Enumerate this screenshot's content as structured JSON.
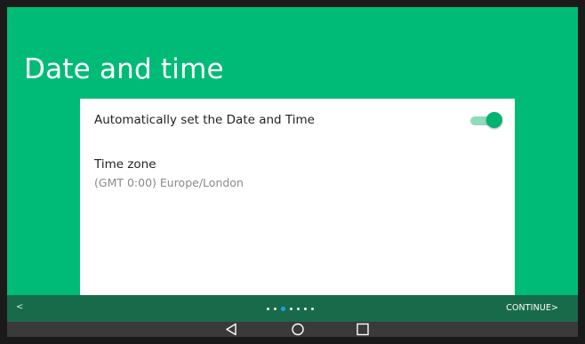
{
  "screen": {
    "title": "Date and time"
  },
  "settings": {
    "auto_datetime_label": "Automatically set the Date and Time",
    "auto_datetime_enabled": true,
    "timezone_label": "Time zone",
    "timezone_value": "(GMT 0:00) Europe/London"
  },
  "footer": {
    "back_label": "<",
    "continue_label": "CONTINUE>",
    "page_count": 7,
    "current_page": 3
  },
  "nav": {
    "back_icon": "triangle-back-icon",
    "home_icon": "circle-home-icon",
    "recents_icon": "square-recents-icon"
  },
  "colors": {
    "background": "#00bb77",
    "footer": "#186b4a",
    "accent": "#00b272",
    "active_dot": "#1ea0e8",
    "navbar": "#3a3a3a"
  }
}
